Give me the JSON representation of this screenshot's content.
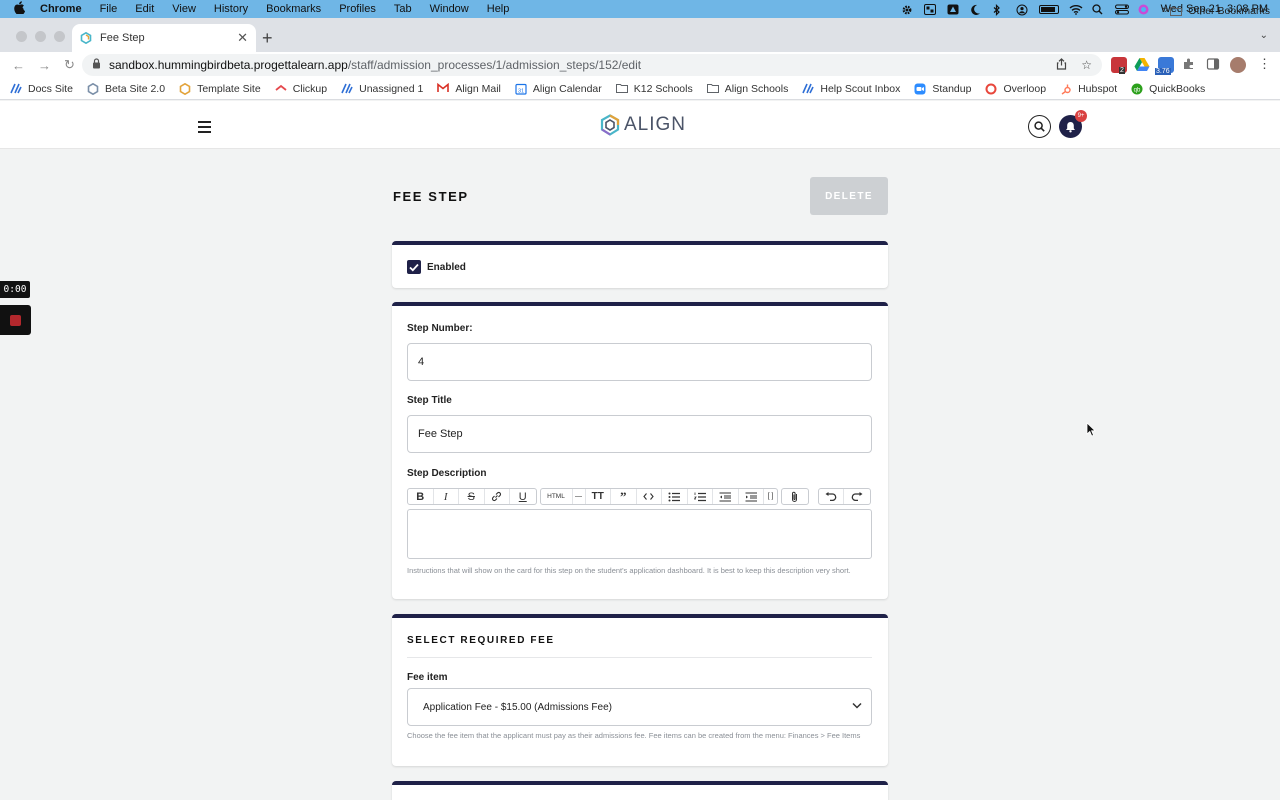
{
  "menubar": {
    "app": "Chrome",
    "items": [
      "File",
      "Edit",
      "View",
      "History",
      "Bookmarks",
      "Profiles",
      "Tab",
      "Window",
      "Help"
    ],
    "datetime": "Wed Sep 21  3:08 PM"
  },
  "browser": {
    "tab_title": "Fee Step",
    "url_host": "sandbox.hummingbirdbeta.progettalearn.app",
    "url_path": "/staff/admission_processes/1/admission_steps/152/edit",
    "ext_badges": [
      "2",
      "3.76"
    ],
    "bookmarks": [
      {
        "label": "Docs Site",
        "icon": "align-logo-icon",
        "color": "#2f6fd6"
      },
      {
        "label": "Beta Site 2.0",
        "icon": "hex-logo-icon",
        "color": "#7b8fa8"
      },
      {
        "label": "Template Site",
        "icon": "hex-logo-icon",
        "color": "#e3a33a"
      },
      {
        "label": "Clickup",
        "icon": "clickup-icon",
        "color": "#e5484d"
      },
      {
        "label": "Unassigned 1",
        "icon": "align-logo-icon",
        "color": "#2f6fd6"
      },
      {
        "label": "Align Mail",
        "icon": "gmail-icon",
        "color": "#d93025"
      },
      {
        "label": "Align Calendar",
        "icon": "calendar-icon",
        "color": "#1a73e8"
      },
      {
        "label": "K12 Schools",
        "icon": "folder-icon",
        "color": "#5f6368"
      },
      {
        "label": "Align Schools",
        "icon": "folder-icon",
        "color": "#5f6368"
      },
      {
        "label": "Help Scout Inbox",
        "icon": "align-logo-icon",
        "color": "#2f6fd6"
      },
      {
        "label": "Standup",
        "icon": "zoom-icon",
        "color": "#2d8cff"
      },
      {
        "label": "Overloop",
        "icon": "overloop-icon",
        "color": "#e8473c"
      },
      {
        "label": "Hubspot",
        "icon": "hubspot-icon",
        "color": "#ff7a59"
      },
      {
        "label": "QuickBooks",
        "icon": "quickbooks-icon",
        "color": "#2ca01c"
      }
    ],
    "more_label": "»",
    "other_bookmarks": "Other Bookmarks"
  },
  "app": {
    "logo_text": "ALIGN",
    "notification_count": "9+"
  },
  "recorder": {
    "time": "0:00"
  },
  "page": {
    "title": "FEE STEP",
    "delete_label": "DELETE",
    "enabled_label": "Enabled",
    "step_number_label": "Step Number:",
    "step_number_value": "4",
    "step_title_label": "Step Title",
    "step_title_value": "Fee Step",
    "step_description_label": "Step Description",
    "description_help": "Instructions that will show on the card for this step on the student's application dashboard. It is best to keep this description very short.",
    "fee_section_title": "SELECT REQUIRED FEE",
    "fee_item_label": "Fee item",
    "fee_item_value": "Application Fee - $15.00 (Admissions Fee)",
    "fee_help": "Choose the fee item that the applicant must pay as their admissions fee. Fee items can be created from the menu: Finances > Fee Items"
  },
  "rte": {
    "html_label": "HTML"
  },
  "colors": {
    "navy": "#1f2148",
    "menubar": "#6fb6e6",
    "page_bg": "#f2f3f3",
    "delete_disabled": "#cdd0d3"
  }
}
